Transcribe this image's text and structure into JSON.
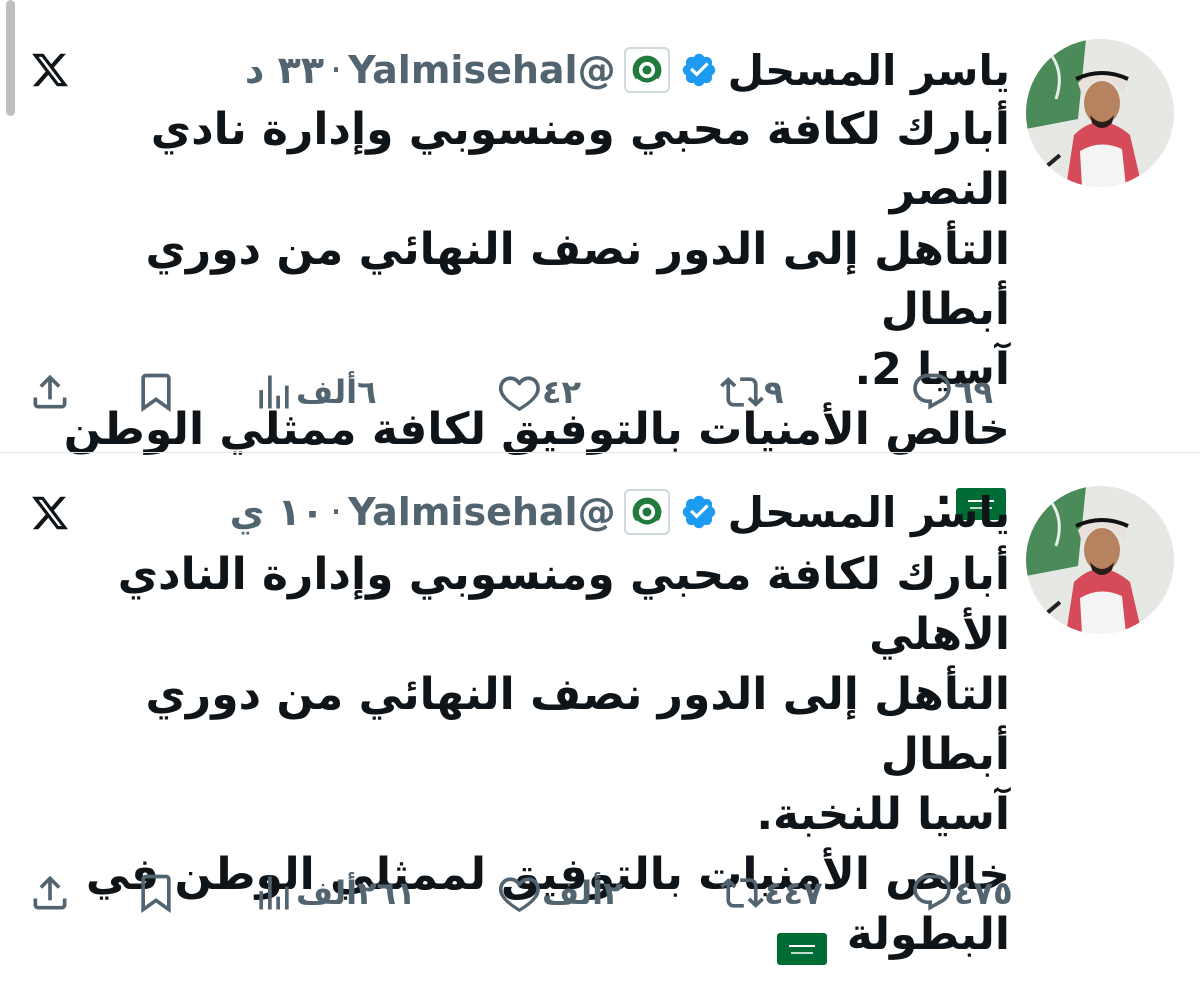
{
  "tweets": [
    {
      "author": "ياسر المسحل",
      "handle": "@Yalmisehal",
      "separator": "·",
      "time": "٣٣ د",
      "text_lines": "أبارك لكافة محبي ومنسوبي وإدارة نادي النصر\nالتأهل إلى الدور نصف النهائي من دوري أبطال\nآسيا 2.\nخالص الأمنيات بالتوفيق لكافة ممثلي الوطن",
      "text_end": ".",
      "replies": "٦٩",
      "retweets": "٩",
      "likes": "٤٢",
      "views": "٦ألف"
    },
    {
      "author": "ياسر المسحل",
      "handle": "@Yalmisehal",
      "separator": "·",
      "time": "١٠ ي",
      "text_lines": "أبارك لكافة محبي ومنسوبي وإدارة النادي الأهلي\nالتأهل إلى الدور نصف النهائي من دوري أبطال\nآسيا للنخبة.\nخالص الأمنيات بالتوفيق لممثلي الوطن في\nالبطولة",
      "text_end": "",
      "replies": "٤٧٥",
      "retweets": "٤٤٧",
      "likes": "٢ألف",
      "views": "٢٦١ألف"
    }
  ],
  "icons": {
    "verified": "verified-badge-icon",
    "affiliate": "saudi-football-federation-icon",
    "platform": "x-logo-icon",
    "flag": "saudi-flag-icon",
    "reply": "reply-icon",
    "retweet": "retweet-icon",
    "like": "heart-icon",
    "views": "views-icon",
    "bookmark": "bookmark-icon",
    "share": "share-icon"
  },
  "colors": {
    "verified": "#1d9bf0",
    "secondary_text": "#536471",
    "primary_text": "#0f1419",
    "flag_green": "#006c35",
    "divider": "#e4e7ea"
  }
}
